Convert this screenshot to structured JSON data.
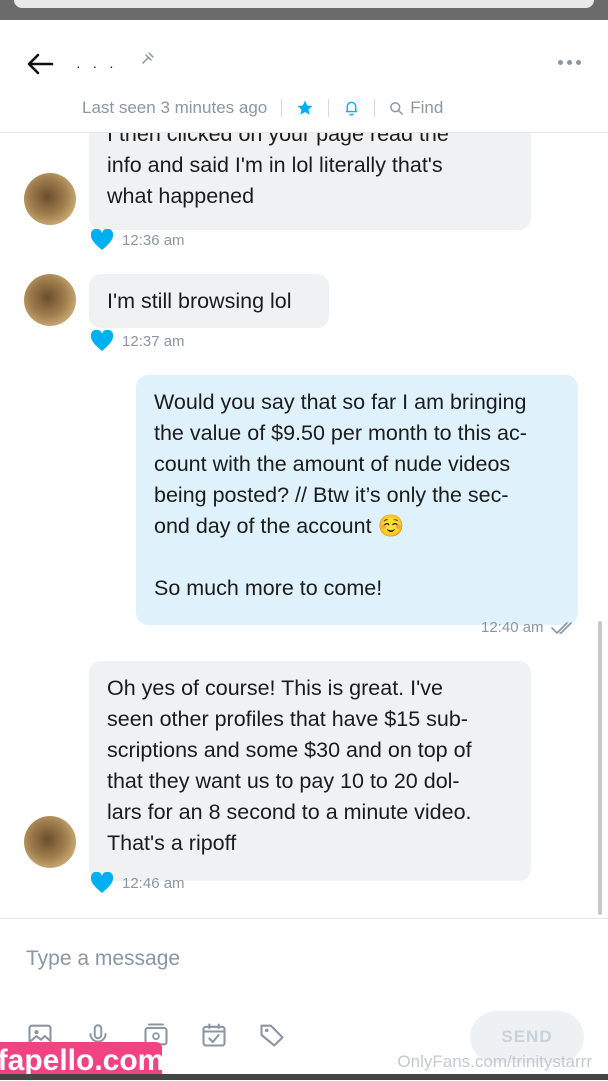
{
  "header": {
    "username": "· · ·",
    "last_seen": "Last seen 3 minutes ago",
    "find_label": "Find"
  },
  "messages": [
    {
      "direction": "incoming",
      "lines": [
        "I then clicked on your page read the",
        "info and said I'm in lol literally that's",
        "what happened"
      ],
      "time": "12:36 am"
    },
    {
      "direction": "incoming",
      "lines": [
        "I'm still browsing lol"
      ],
      "time": "12:37 am"
    },
    {
      "direction": "outgoing",
      "lines": [
        "Would you say that so far I am bringing",
        "the value of $9.50 per month to this ac-",
        "count with the amount of nude videos",
        "being posted? // Btw it’s only the sec-",
        "ond day of the account ☺️",
        "",
        "So much more to come!"
      ],
      "time": "12:40 am"
    },
    {
      "direction": "incoming",
      "lines": [
        "Oh yes of course! This is great. I've",
        "seen other profiles that have $15 sub-",
        "scriptions and some $30 and on top of",
        "that they want us to pay 10 to 20 dol-",
        "lars for an 8 second to a minute video.",
        "That's a ripoff"
      ],
      "time": "12:46 am"
    }
  ],
  "composer": {
    "placeholder": "Type a message",
    "send_label": "SEND"
  },
  "watermarks": {
    "left": "fapello.com",
    "right": "OnlyFans.com/trinitystarrr"
  },
  "colors": {
    "accent": "#00aff0",
    "incoming_bubble": "#f0f1f3",
    "outgoing_bubble": "#dff2fc",
    "muted_text": "#8a96a3"
  }
}
